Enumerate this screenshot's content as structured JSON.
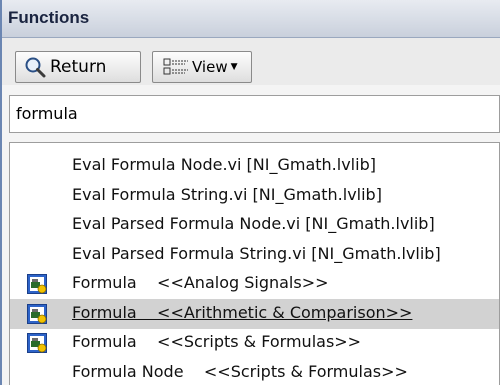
{
  "palette": {
    "title": "Functions",
    "toolbar": {
      "return_label": "Return",
      "return_icon": "magnifier-icon",
      "view_label": "View",
      "view_icon": "view-list-icon",
      "view_dropdown_icon": "dropdown-arrow-icon"
    },
    "search": {
      "value": "formula"
    },
    "results": [
      {
        "label": "Eval Formula Node.vi [NI_Gmath.lvlib]",
        "icon": null,
        "selected": false
      },
      {
        "label": "Eval Formula String.vi [NI_Gmath.lvlib]",
        "icon": null,
        "selected": false
      },
      {
        "label": "Eval Parsed Formula Node.vi [NI_Gmath.lvlib]",
        "icon": null,
        "selected": false
      },
      {
        "label": "Eval Parsed Formula String.vi [NI_Gmath.lvlib]",
        "icon": null,
        "selected": false
      },
      {
        "label": "Formula    <<Analog Signals>>",
        "icon": "express-vi-icon",
        "selected": false
      },
      {
        "label": "Formula    <<Arithmetic & Comparison>>",
        "icon": "express-vi-icon",
        "selected": true
      },
      {
        "label": "Formula    <<Scripts & Formulas>>",
        "icon": "express-vi-icon",
        "selected": false
      },
      {
        "label": "Formula Node    <<Scripts & Formulas>>",
        "icon": null,
        "selected": false
      }
    ]
  },
  "colors": {
    "selected_row": "#d2d2d2",
    "title_bar": "#c9d0dc",
    "accent_border": "#6b86b2"
  }
}
